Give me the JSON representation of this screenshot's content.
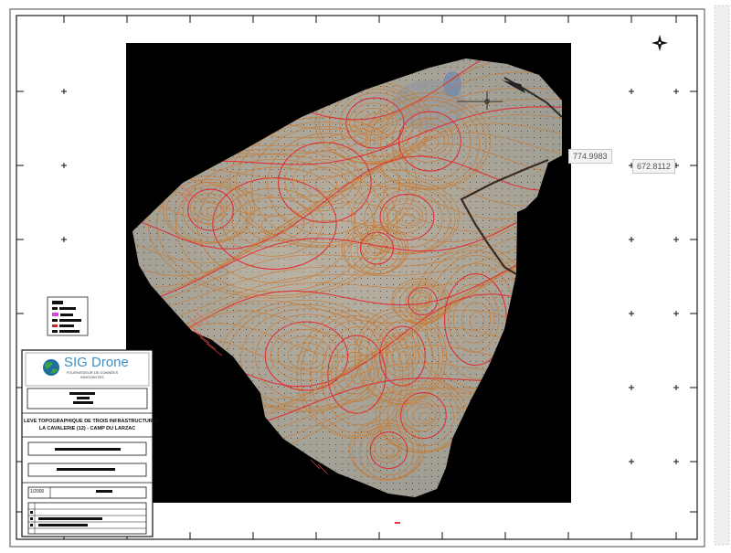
{
  "map": {
    "coord_x_label": "774.9983",
    "coord_y_label": "672.8112",
    "north_arrow_icon": "north-arrow-icon"
  },
  "title_block": {
    "logo_name": "SIG Drone",
    "logo_tagline_1": "FOURNISSEUR DE DONNÉES",
    "logo_tagline_2": "INNOVANTES",
    "survey_title_1": "LEVE TOPOGRAPHIQUE DE TROIS INFRASTRUCTURES",
    "survey_title_2": "LA CAVALERIE (12) - CAMP DU LARZAC",
    "scale": "1/2000"
  },
  "colors": {
    "contour_major": "#e8202a",
    "contour_minor": "#c9782e",
    "background_mask": "#000000",
    "logo_blue": "#3e8fbf",
    "legend_magenta": "#e040e0"
  }
}
